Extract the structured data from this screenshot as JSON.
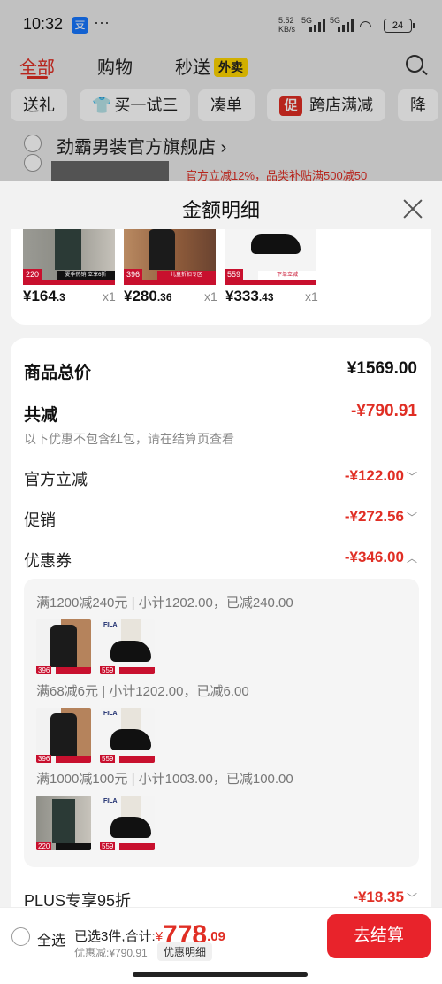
{
  "status_bar": {
    "time": "10:32",
    "app_icon_label": "支",
    "more_dots": "···",
    "speed_value": "5.52",
    "speed_unit": "KB/s",
    "net1": "5G",
    "net2": "5G",
    "battery": "24"
  },
  "top_tabs": {
    "items": [
      "全部",
      "购物",
      "秒送"
    ],
    "waimai_badge": "外卖",
    "active": "全部"
  },
  "filter_chips": [
    "送礼",
    "买一试三",
    "凑单",
    "跨店满减",
    "降"
  ],
  "filter_chip_promo_badge": "促",
  "store": {
    "name": "劲霸男装官方旗舰店",
    "arrow": "›",
    "promo": "官方立减12%，品类补贴满500减50"
  },
  "sheet": {
    "title": "金额明细",
    "products": [
      {
        "price_int": "¥164",
        "price_dec": ".3",
        "qty": "x1",
        "badge": "220",
        "tag": "夏季热销 立享6折"
      },
      {
        "price_int": "¥280",
        "price_dec": ".36",
        "qty": "x1",
        "badge": "396",
        "tag": "儿童折扣专区"
      },
      {
        "price_int": "¥333",
        "price_dec": ".43",
        "qty": "x1",
        "badge": "559",
        "tag": "下单立减"
      }
    ],
    "detail": {
      "total_label": "商品总价",
      "total_value": "¥1569.00",
      "reduce_label": "共减",
      "reduce_value": "-¥790.91",
      "reduce_note": "以下优惠不包含红包，请在结算页查看",
      "official_label": "官方立减",
      "official_value": "-¥122.00",
      "promo_label": "促销",
      "promo_value": "-¥272.56",
      "coupon_label": "优惠券",
      "coupon_value": "-¥346.00",
      "coupons": [
        {
          "line": "满1200减240元 | 小计1202.00，已减240.00",
          "thumbs": [
            "396",
            "559"
          ]
        },
        {
          "line": "满68减6元 | 小计1202.00，已减6.00",
          "thumbs": [
            "396",
            "559"
          ]
        },
        {
          "line": "满1000减100元 | 小计1003.00，已减100.00",
          "thumbs": [
            "220",
            "559"
          ]
        }
      ],
      "plus_label": "PLUS专享95折",
      "plus_value": "-¥18.35"
    }
  },
  "bottom_bar": {
    "select_all": "全选",
    "summary_prefix": "已选3件,合计:",
    "currency": "¥",
    "total_int": "778",
    "total_dec": ".09",
    "discount_text": "优惠减:¥790.91",
    "detail_button": "优惠明细",
    "checkout": "去结算"
  },
  "colors": {
    "accent": "#e02e24",
    "checkout": "#e8232b"
  }
}
